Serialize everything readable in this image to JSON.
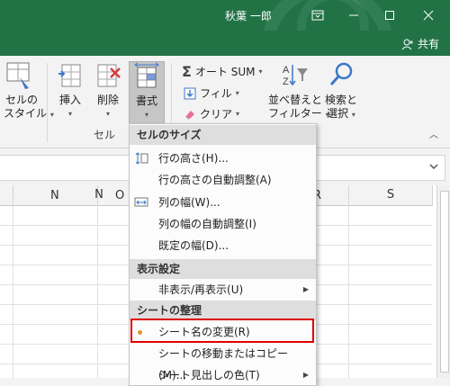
{
  "titlebar": {
    "user_name": "秋葉 一郎",
    "color": "#217346"
  },
  "share": {
    "label": "共有"
  },
  "ribbon": {
    "cell_style": {
      "line1": "セルの",
      "line2": "スタイル"
    },
    "insert": "挿入",
    "delete": "削除",
    "format": "書式",
    "cells_group": "セル",
    "autosum": "オート SUM",
    "fill": "フィル",
    "clear": "クリア",
    "sort_filter": {
      "line1": "並べ替えと",
      "line2": "フィルター"
    },
    "find_select": {
      "line1": "検索と",
      "line2": "選択"
    }
  },
  "sheet": {
    "columns": [
      "N",
      "O",
      "R",
      "S"
    ]
  },
  "menu": {
    "header_cell_size": "セルのサイズ",
    "row_height": "行の高さ(H)...",
    "autofit_row": "行の高さの自動調整(A)",
    "col_width": "列の幅(W)...",
    "autofit_col": "列の幅の自動調整(I)",
    "default_width": "既定の幅(D)...",
    "header_visibility": "表示設定",
    "hide_unhide": "非表示/再表示(U)",
    "header_organize": "シートの整理",
    "rename_sheet": "シート名の変更(R)",
    "move_copy": "シートの移動またはコピー(M)...",
    "tab_color": "シート見出しの色(T)"
  },
  "colors": {
    "accent": "#217346",
    "highlight_border": "#e00000",
    "bullet": "#e8942a"
  }
}
